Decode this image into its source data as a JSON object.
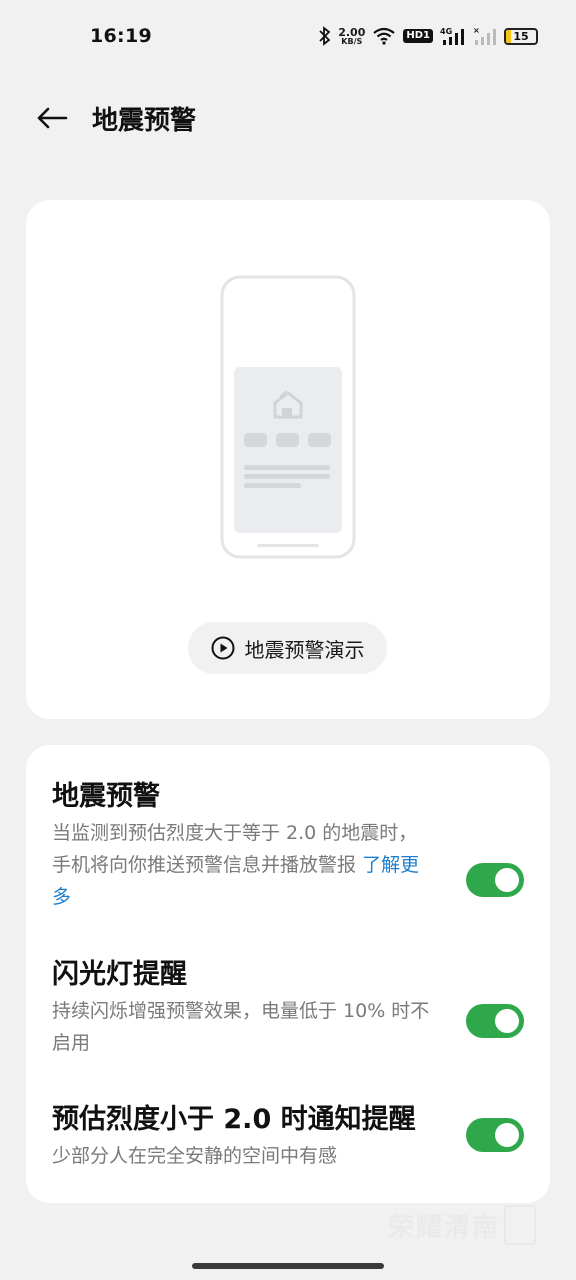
{
  "status": {
    "time": "16:19",
    "net_speed_value": "2.00",
    "net_speed_unit": "KB/S",
    "hd_label": "HD1",
    "network_type": "4G",
    "battery_level": "15",
    "battery_fraction": 0.15,
    "icons": [
      "bluetooth-icon",
      "wifi-icon",
      "hd-icon",
      "signal-4g-icon",
      "signal-empty-icon",
      "battery-icon"
    ]
  },
  "header": {
    "back_icon": "back-arrow-icon",
    "title": "地震预警"
  },
  "demo": {
    "illustration": "phone-alert-illustration",
    "button_label": "地震预警演示",
    "button_icon": "play-icon"
  },
  "settings": [
    {
      "title": "地震预警",
      "description": "当监测到预估烈度大于等于 2.0 的地震时，手机将向你推送预警信息并播放警报",
      "link": "了解更多",
      "enabled": true
    },
    {
      "title": "闪光灯提醒",
      "description": "持续闪烁增强预警效果，电量低于 10% 时不启用",
      "enabled": true
    },
    {
      "title": "预估烈度小于 2.0 时通知提醒",
      "description": "少部分人在完全安静的空间中有感",
      "enabled": true
    }
  ],
  "watermark": {
    "text": "荣耀渭南"
  },
  "colors": {
    "background": "#f1f1f1",
    "card": "#ffffff",
    "toggle_on": "#2ea84a",
    "link": "#1d7fd1",
    "battery": "#f3c316"
  }
}
